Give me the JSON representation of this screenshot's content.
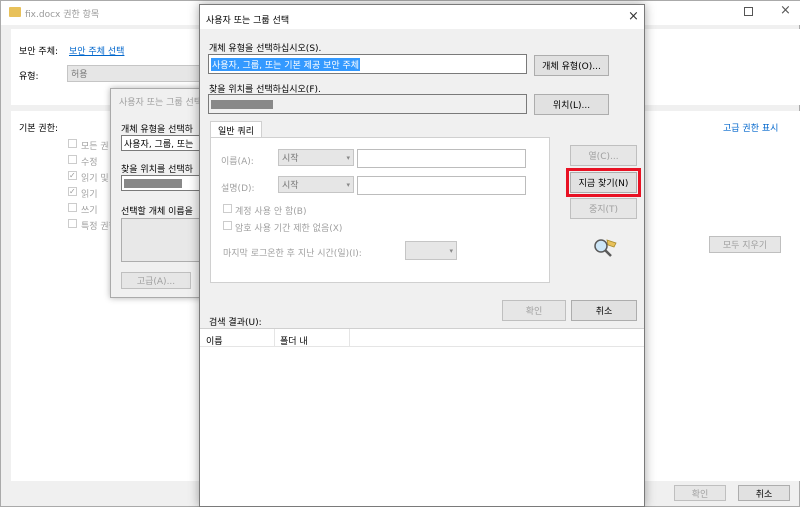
{
  "bg_window": {
    "title": "fix.docx 권한 항목",
    "principal_label": "보안 주체:",
    "principal_link": "보안 주체 선택",
    "type_label": "유형:",
    "type_value": "허용",
    "basic_perms_label": "기본 권한:",
    "advanced_link": "고급 권한 표시",
    "perms": [
      {
        "label": "모든 권",
        "checked": false
      },
      {
        "label": "수정",
        "checked": false
      },
      {
        "label": "읽기 및",
        "checked": true
      },
      {
        "label": "읽기",
        "checked": true
      },
      {
        "label": "쓰기",
        "checked": false
      },
      {
        "label": "특정 권한",
        "checked": false
      }
    ],
    "clear_all_button": "모두 지우기",
    "ok_button": "확인",
    "cancel_button": "취소"
  },
  "mid_dialog": {
    "title": "사용자 또는 그룹 선택",
    "object_type_label": "개체 유형을 선택하",
    "object_type_value": "사용자, 그룹, 또는",
    "location_label": "찾을 위치를 선택하",
    "enter_names_label": "선택할 개체 이름을",
    "advanced_button": "고급(A)..."
  },
  "dialog": {
    "title": "사용자 또는 그룹 선택",
    "object_type_label": "개체 유형을 선택하십시오(S).",
    "object_type_value": "사용자, 그룹, 또는 기본 제공 보안 주체",
    "object_types_button": "개체 유형(O)...",
    "location_label": "찾을 위치를 선택하십시오(F).",
    "locations_button": "위치(L)...",
    "tab_common_queries": "일반 쿼리",
    "name_label": "이름(A):",
    "name_op": "시작",
    "desc_label": "설명(D):",
    "desc_op": "시작",
    "disabled_accounts": "계정 사용 안 함(B)",
    "non_expiring": "암호 사용 기간 제한 없음(X)",
    "days_since_logon": "마지막 로그온한 후 지난 시간(일)(I):",
    "columns_button": "열(C)...",
    "find_now_button": "지금 찾기(N)",
    "stop_button": "중지(T)",
    "ok_button": "확인",
    "cancel_button": "취소",
    "search_results_label": "검색 결과(U):",
    "results_columns": [
      "이름",
      "폴더 내"
    ],
    "highlight_color": "#e81123"
  }
}
